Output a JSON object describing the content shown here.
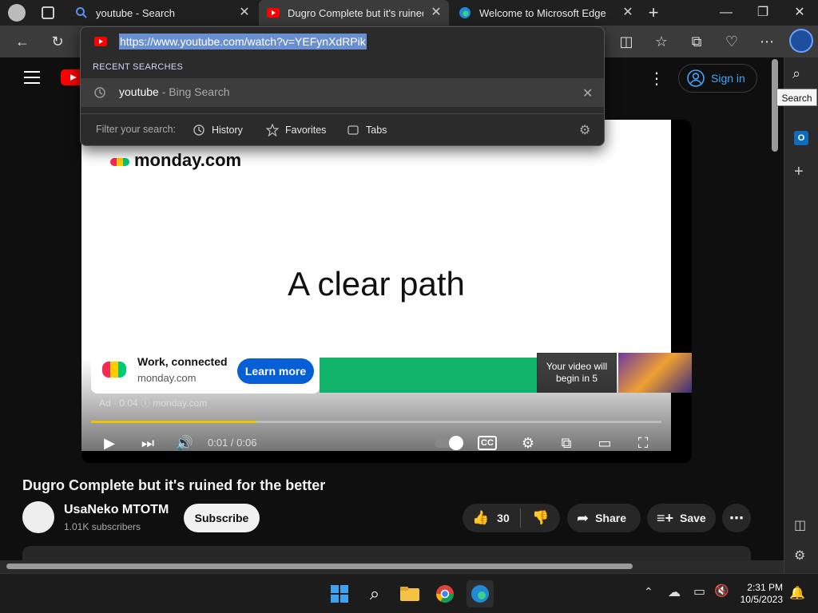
{
  "tabs": [
    {
      "title": "youtube - Search",
      "active": false
    },
    {
      "title": "Dugro Complete but it's ruined f",
      "active": true
    },
    {
      "title": "Welcome to Microsoft Edge",
      "active": false
    }
  ],
  "address_bar": {
    "url": "https://www.youtube.com/watch?v=YEFynXdRPik",
    "recent_label": "RECENT SEARCHES",
    "recent_query": "youtube",
    "recent_source": " - Bing Search",
    "filter_label": "Filter your search:",
    "filter_history": "History",
    "filter_favorites": "Favorites",
    "filter_tabs": "Tabs"
  },
  "youtube": {
    "sign_in": "Sign in",
    "ad": {
      "brand": "monday.com",
      "headline": "A clear path",
      "card_title": "Work, connected",
      "card_domain": "monday.com",
      "cta": "Learn more",
      "skip_text": "Your video will begin in 5",
      "meta": "Ad · 0:04 ⓘ   monday.com",
      "progress": 0.29
    },
    "player": {
      "timecode": "0:01 / 0:06"
    },
    "video_title": "Dugro Complete but it's ruined for the better",
    "channel": {
      "name": "UsaNeko MTOTM",
      "subscribers": "1.01K subscribers"
    },
    "subscribe": "Subscribe",
    "likes": "30",
    "share": "Share",
    "save": "Save"
  },
  "sidebar": {
    "tooltip": "Search"
  },
  "taskbar": {
    "time": "2:31 PM",
    "date": "10/5/2023"
  },
  "colors": {
    "accent": "#3ea6ff",
    "youtube_red": "#ff0000",
    "ad_green": "#12b36b",
    "cta_blue": "#065fd4"
  }
}
